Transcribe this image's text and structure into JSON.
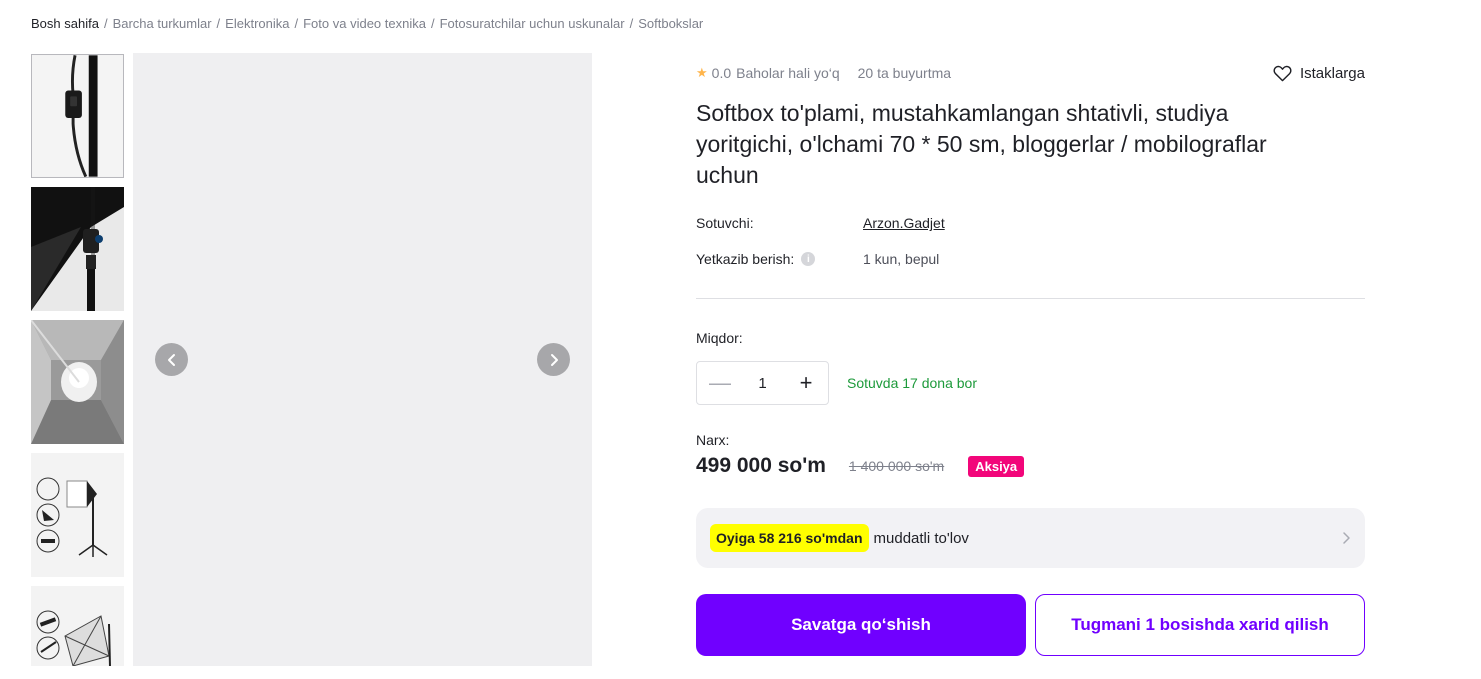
{
  "breadcrumb": [
    "Bosh sahifa",
    "Barcha turkumlar",
    "Elektronika",
    "Foto va video texnika",
    "Fotosuratchilar uchun uskunalar",
    "Softbokslar"
  ],
  "gallery": {
    "thumbnails": [
      "softbox-switch-cable",
      "softbox-bulb-socket",
      "softbox-interior-lamp",
      "softbox-kit-diagram",
      "softbox-parts-diagram"
    ],
    "prev_icon": "chevron-left-icon",
    "next_icon": "chevron-right-icon"
  },
  "product": {
    "rating": "0.0",
    "rating_text": "Baholar hali yo‘q",
    "orders": "20 ta buyurtma",
    "wishlist_label": "Istaklarga",
    "title": "Softbox to'plami, mustahkamlangan shtativli, studiya yoritgichi, o'lchami 70 * 50 sm, bloggerlar / mobilograflar uchun",
    "seller_label": "Sotuvchi:",
    "seller_name": "Arzon.Gadjet",
    "delivery_label": "Yetkazib berish:",
    "delivery_value": "1 kun, bepul",
    "quantity_label": "Miqdor:",
    "quantity": "1",
    "stock": "Sotuvda 17 dona bor",
    "price_label": "Narx:",
    "price": "499 000 so'm",
    "old_price": "1 400 000 so'm",
    "badge": "Aksiya",
    "installment_highlight": "Oyiga 58 216 so'mdan",
    "installment_text": "muddatli to'lov",
    "add_to_cart": "Savatga qo‘shish",
    "one_click": "Tugmani 1 bosishda xarid qilish"
  },
  "colors": {
    "accent": "#7000ff",
    "badge": "#f2067a",
    "stock": "#1d9a3b",
    "highlight": "#ffff00",
    "star": "#ffb54c"
  }
}
